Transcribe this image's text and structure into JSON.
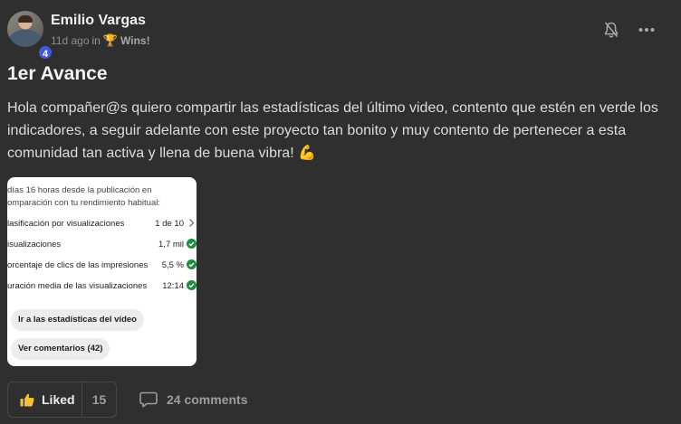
{
  "post": {
    "author": {
      "name": "Emilio Vargas",
      "level": "4"
    },
    "meta": {
      "time": "11d ago",
      "in_word": "in",
      "category_icon": "trophy-icon",
      "category": "Wins!"
    },
    "actions": {
      "notification_icon": "bell-icon",
      "more_icon": "more-icon"
    },
    "title": "1er Avance",
    "body": "Hola compañer@s quiero compartir las estadísticas del último video, contento que estén en verde los indicadores, a seguir adelante con este proyecto tan bonito y muy contento de pertenecer a esta comunidad tan activa y llena de buena vibra! 💪",
    "attachment": {
      "intro_line1": "días 16 horas desde la publicación en",
      "intro_line2": "omparación con tu rendimiento habitual:",
      "stats": [
        {
          "label": "lasificación por visualizaciones",
          "value": "1 de 10",
          "indicator": "chevron-right-icon"
        },
        {
          "label": "isualizaciones",
          "value": "1,7 mil",
          "indicator": "green-check-icon"
        },
        {
          "label": "orcentaje de clics de las impresiones",
          "value": "5,5 %",
          "indicator": "green-check-icon"
        },
        {
          "label": "uración media de las visualizaciones",
          "value": "12:14",
          "indicator": "green-check-icon"
        }
      ],
      "button_stats": "Ir a las estadísticas del vídeo",
      "button_comments": "Ver comentarios (42)"
    },
    "footer": {
      "like_label": "Liked",
      "like_count": "15",
      "comments_label": "24 comments"
    }
  },
  "colors": {
    "background": "#2f2f2f",
    "level_badge": "#3d5bd6",
    "check_green": "#1e8e3e",
    "trophy": "#d7a63a"
  }
}
